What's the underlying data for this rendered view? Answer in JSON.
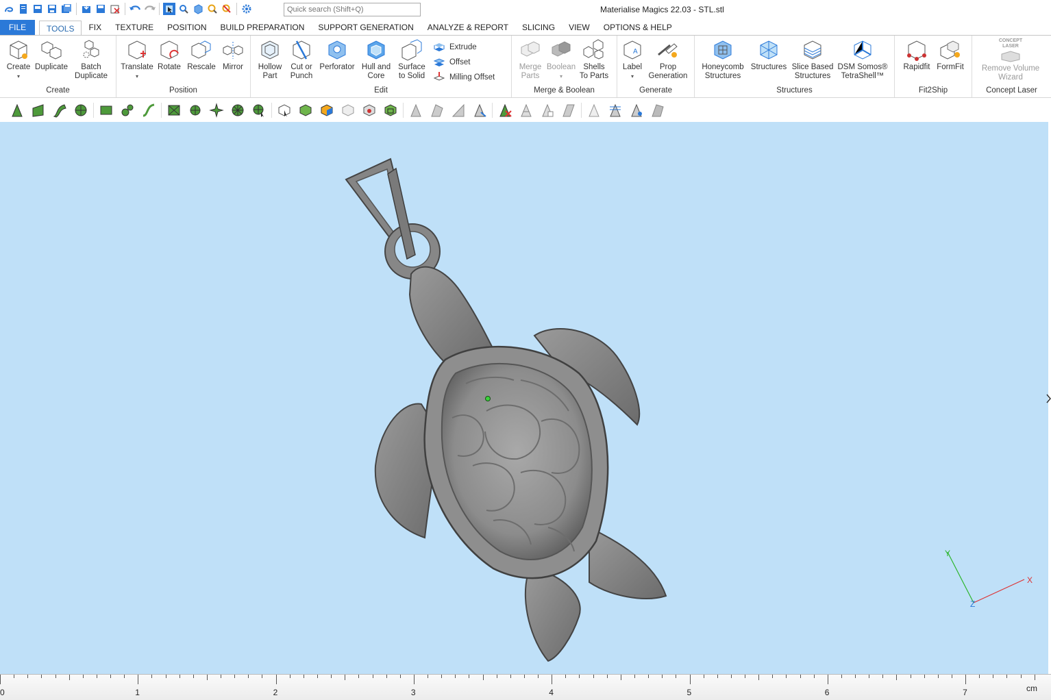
{
  "window": {
    "title": "Materialise Magics 22.03 - STL.stl"
  },
  "search": {
    "placeholder": "Quick search (Shift+Q)"
  },
  "tabs": [
    {
      "label": "FILE"
    },
    {
      "label": "TOOLS"
    },
    {
      "label": "FIX"
    },
    {
      "label": "TEXTURE"
    },
    {
      "label": "POSITION"
    },
    {
      "label": "BUILD PREPARATION"
    },
    {
      "label": "SUPPORT GENERATION"
    },
    {
      "label": "ANALYZE & REPORT"
    },
    {
      "label": "SLICING"
    },
    {
      "label": "VIEW"
    },
    {
      "label": "OPTIONS & HELP"
    }
  ],
  "ribbon": {
    "create": {
      "label": "Create",
      "create": "Create",
      "duplicate": "Duplicate",
      "batch1": "Batch",
      "batch2": "Duplicate"
    },
    "position": {
      "label": "Position",
      "translate": "Translate",
      "rotate": "Rotate",
      "rescale": "Rescale",
      "mirror": "Mirror"
    },
    "edit": {
      "label": "Edit",
      "hollow1": "Hollow",
      "hollow2": "Part",
      "cut1": "Cut or",
      "cut2": "Punch",
      "perforator": "Perforator",
      "hull1": "Hull and",
      "hull2": "Core",
      "surface1": "Surface",
      "surface2": "to Solid",
      "extrude": "Extrude",
      "offset": "Offset",
      "milling": "Milling Offset"
    },
    "merge": {
      "label": "Merge & Boolean",
      "merge1": "Merge",
      "merge2": "Parts",
      "boolean": "Boolean",
      "shells1": "Shells",
      "shells2": "To Parts"
    },
    "generate": {
      "label": "Generate",
      "labelbtn": "Label",
      "prop1": "Prop",
      "prop2": "Generation"
    },
    "structures": {
      "label": "Structures",
      "honey1": "Honeycomb",
      "honey2": "Structures",
      "structures": "Structures",
      "slice1": "Slice Based",
      "slice2": "Structures",
      "dsm1": "DSM Somos®",
      "dsm2": "TetraShell™"
    },
    "fit2ship": {
      "label": "Fit2Ship",
      "rapidfit": "Rapidfit",
      "formfit": "FormFit"
    },
    "concept": {
      "label": "Concept Laser",
      "logo1": "CONCEPT",
      "logo2": "LASER",
      "remove1": "Remove Volume",
      "remove2": "Wizard"
    }
  },
  "axes": {
    "x": "X",
    "y": "Y",
    "z": "Z"
  },
  "ruler": {
    "unit": "cm",
    "labels": [
      "0",
      "1",
      "2",
      "3",
      "4",
      "5",
      "6",
      "7"
    ]
  },
  "colors": {
    "viewport": "#bfe0f8",
    "model": "#8a8a8a",
    "accent": "#2b79d8"
  }
}
